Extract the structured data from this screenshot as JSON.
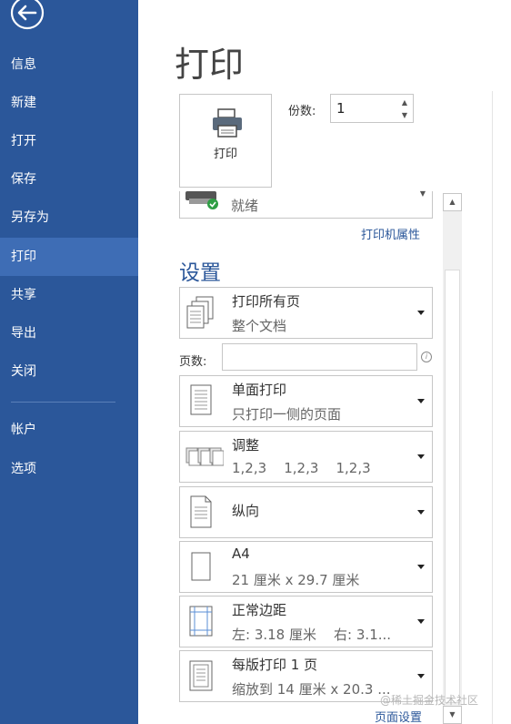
{
  "sidebar": {
    "items": [
      {
        "label": "信息"
      },
      {
        "label": "新建"
      },
      {
        "label": "打开"
      },
      {
        "label": "保存"
      },
      {
        "label": "另存为"
      },
      {
        "label": "打印"
      },
      {
        "label": "共享"
      },
      {
        "label": "导出"
      },
      {
        "label": "关闭"
      },
      {
        "label": "帐户"
      },
      {
        "label": "选项"
      }
    ],
    "active_index": 5
  },
  "main": {
    "title": "打印",
    "print_button_label": "打印",
    "copies_label": "份数:",
    "copies_value": "1",
    "printer_status": "就绪",
    "printer_properties_link": "打印机属性",
    "settings_title": "设置",
    "pages_label": "页数:",
    "pages_value": "",
    "page_setup_link": "页面设置",
    "options": [
      {
        "main": "打印所有页",
        "sub": "整个文档",
        "icon": "pages-stack-icon"
      },
      {
        "main": "单面打印",
        "sub": "只打印一侧的页面",
        "icon": "single-side-icon"
      },
      {
        "main": "调整",
        "sub": "1,2,3    1,2,3    1,2,3",
        "icon": "collate-icon"
      },
      {
        "main": "纵向",
        "sub": "",
        "icon": "portrait-icon"
      },
      {
        "main": "A4",
        "sub": "21 厘米 x 29.7 厘米",
        "icon": "paper-size-icon"
      },
      {
        "main": "正常边距",
        "sub": "左: 3.18 厘米    右: 3.1...",
        "icon": "margins-icon"
      },
      {
        "main": "每版打印 1 页",
        "sub": "缩放到 14 厘米 x 20.3 ...",
        "icon": "pages-per-sheet-icon"
      }
    ]
  },
  "watermark": "@稀土掘金技术社区",
  "colors": {
    "accent": "#2b579a",
    "active_nav": "#3e6db5"
  }
}
